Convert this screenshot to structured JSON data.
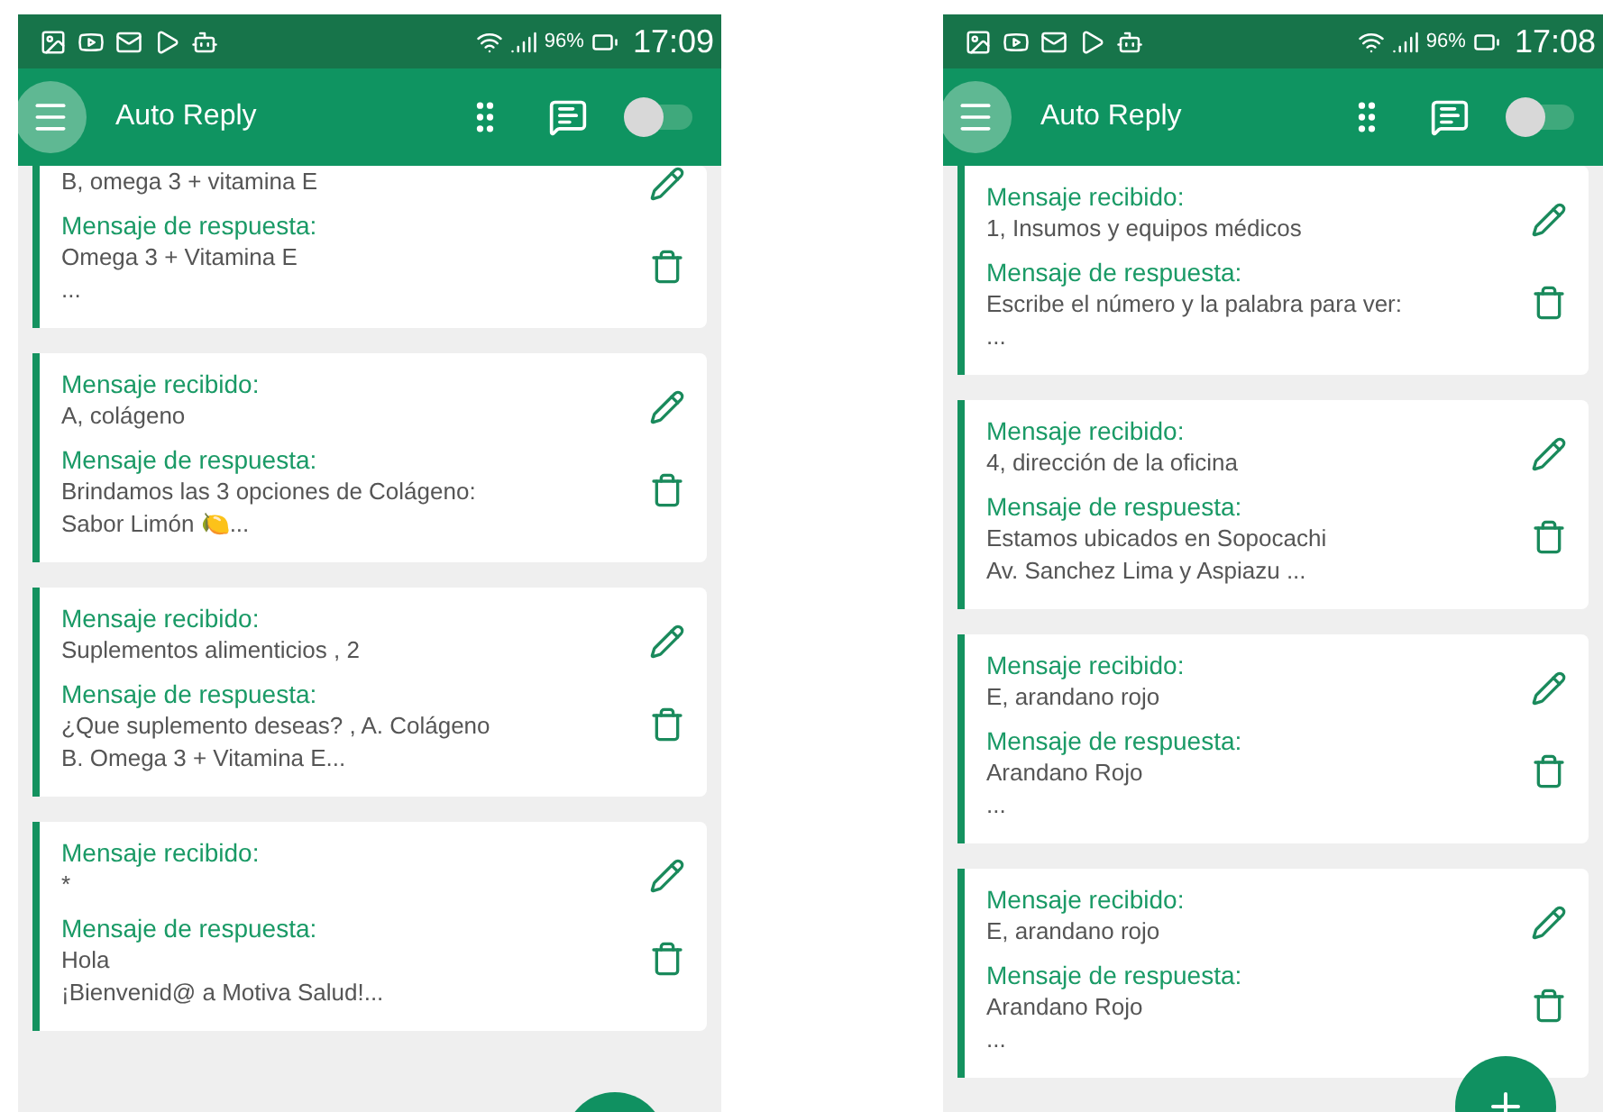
{
  "phones": [
    {
      "status_bar": {
        "battery": "96%",
        "time": "17:09"
      },
      "app_bar": {
        "title": "Auto Reply",
        "switch": {
          "on": false
        }
      },
      "rules": [
        {
          "received": "B, omega 3 + vitamina E",
          "response_label": "Mensaje de respuesta:",
          "response": "Omega 3 + Vitamina E\n..."
        },
        {
          "received_label": "Mensaje recibido:",
          "received": "A, colágeno",
          "response_label": "Mensaje de respuesta:",
          "response": "Brindamos las 3 opciones de Colágeno:\nSabor Limón 🍋..."
        },
        {
          "received_label": "Mensaje recibido:",
          "received": "Suplementos alimenticios , 2",
          "response_label": "Mensaje de respuesta:",
          "response": "¿Que suplemento deseas? , A. Colágeno\nB. Omega 3 + Vitamina E..."
        },
        {
          "received_label": "Mensaje recibido:",
          "received": "*",
          "response_label": "Mensaje de respuesta:",
          "response": "Hola\n¡Bienvenid@ a Motiva Salud!..."
        }
      ]
    },
    {
      "status_bar": {
        "battery": "96%",
        "time": "17:08"
      },
      "app_bar": {
        "title": "Auto Reply",
        "switch": {
          "on": false
        }
      },
      "rules": [
        {
          "received_label": "Mensaje recibido:",
          "received": "1, Insumos y equipos médicos",
          "response_label": "Mensaje de respuesta:",
          "response": "Escribe el número y la palabra para ver:\n..."
        },
        {
          "received_label": "Mensaje recibido:",
          "received": "4, dirección de la oficina",
          "response_label": "Mensaje de respuesta:",
          "response": "Estamos ubicados en Sopocachi\nAv. Sanchez Lima y Aspiazu ..."
        },
        {
          "received_label": "Mensaje recibido:",
          "received": "E, arandano rojo",
          "response_label": "Mensaje de respuesta:",
          "response": "Arandano Rojo\n..."
        },
        {
          "received_label": "Mensaje recibido:",
          "received": "E, arandano rojo",
          "response_label": "Mensaje de respuesta:",
          "response": "Arandano Rojo\n..."
        }
      ]
    }
  ]
}
